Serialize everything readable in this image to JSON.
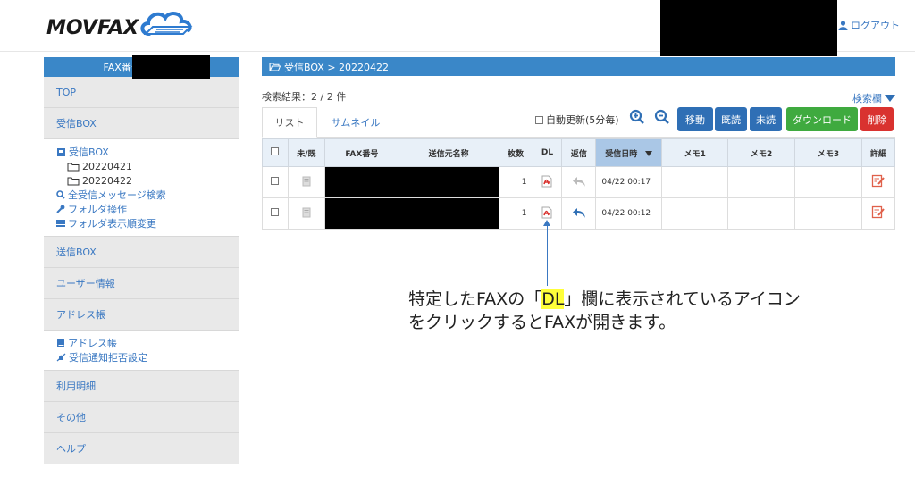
{
  "header": {
    "logo_text": "MOVFAX",
    "logout_label": "ログアウト"
  },
  "sidebar": {
    "fax_number_label": "FAX番号:",
    "top": "TOP",
    "inbox": "受信BOX",
    "inbox_tree": {
      "root": "受信BOX",
      "folders": [
        "20220421",
        "20220422"
      ],
      "search_all": "全受信メッセージ検索",
      "folder_ops": "フォルダ操作",
      "folder_order": "フォルダ表示順変更"
    },
    "outbox": "送信BOX",
    "user_info": "ユーザー情報",
    "address_book": "アドレス帳",
    "address_sub": {
      "address_book": "アドレス帳",
      "reject_settings": "受信通知拒否設定"
    },
    "usage": "利用明細",
    "other": "その他",
    "help": "ヘルプ"
  },
  "main": {
    "breadcrumb": "受信BOX > 20220422",
    "result": "検索結果：2 / 2 件",
    "search_toggle": "検索欄",
    "tabs": [
      "リスト",
      "サムネイル"
    ],
    "auto_refresh": "自動更新(5分毎)",
    "buttons": {
      "move": "移動",
      "read": "既読",
      "unread": "未読",
      "download": "ダウンロード",
      "delete": "削除"
    },
    "table": {
      "headers": [
        "",
        "未/既",
        "FAX番号",
        "送信元名称",
        "枚数",
        "DL",
        "返信",
        "受信日時",
        "メモ1",
        "メモ2",
        "メモ3",
        "詳細"
      ],
      "rows": [
        {
          "pages": "1",
          "received": "04/22 00:17"
        },
        {
          "pages": "1",
          "received": "04/22 00:12"
        }
      ]
    }
  },
  "annotation": {
    "line1_pre": "特定したFAXの「",
    "line1_hl": "DL",
    "line1_post": "」欄に表示されているアイコン",
    "line2": "をクリックするとFAXが開きます。"
  },
  "colors": {
    "accent": "#3a87c8",
    "move": "#2f6fb5",
    "read": "#2f6fb5",
    "unread": "#2f6fb5",
    "download": "#3faa3f",
    "delete": "#d9322f"
  }
}
